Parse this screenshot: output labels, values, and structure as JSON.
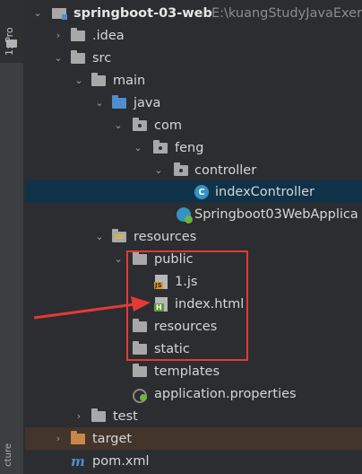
{
  "sidebar_strip": {
    "project_tab_label": "1: Pro",
    "structure_tab_label": "cture"
  },
  "tree": {
    "root_name": "springboot-03-web",
    "root_path": "E:\\kuangStudyJavaExerc",
    "idea": ".idea",
    "src": "src",
    "main": "main",
    "java": "java",
    "com": "com",
    "feng": "feng",
    "controller": "controller",
    "index_controller": "indexController",
    "app_class": "Springboot03WebApplica",
    "resources": "resources",
    "public": "public",
    "js_file": "1.js",
    "index_html": "index.html",
    "resources_sub": "resources",
    "static": "static",
    "templates": "templates",
    "app_properties": "application.properties",
    "test": "test",
    "target": "target",
    "pom": "pom.xml"
  },
  "file_badges": {
    "js": "JS",
    "html": "H",
    "class": "C",
    "maven": "m"
  },
  "colors": {
    "background": "#2b2d30",
    "selection": "#0f3248",
    "excluded": "#43342c",
    "annotation": "#e53935",
    "folder_blue": "#4e8ecf",
    "folder_orange": "#c7874a"
  }
}
